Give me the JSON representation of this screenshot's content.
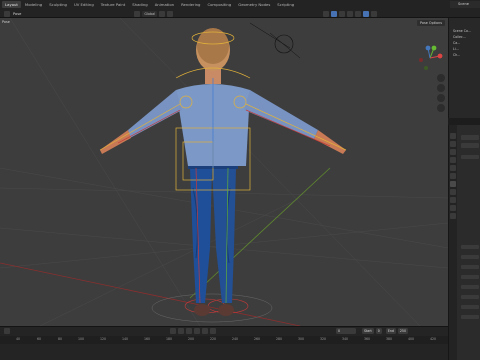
{
  "workspace_tabs": [
    "Layout",
    "Modeling",
    "Sculpting",
    "UV Editing",
    "Texture Paint",
    "Shading",
    "Animation",
    "Rendering",
    "Compositing",
    "Geometry Nodes",
    "Scripting"
  ],
  "active_tab_index": 0,
  "scene_selector": {
    "label": "Scene"
  },
  "viewport_header": {
    "mode": "Pose",
    "pivot": "Global",
    "pose_options": "Pose Options"
  },
  "outliner": {
    "rows": [
      "Scene Co...",
      "Collec...",
      "Ca...",
      "Li...",
      "Ch..."
    ]
  },
  "timeline": {
    "current_frame": "0",
    "start_label": "Start",
    "start_value": "0",
    "end_label": "End",
    "end_value": "250",
    "ticks": [
      "40",
      "60",
      "80",
      "100",
      "120",
      "140",
      "160",
      "180",
      "200",
      "220",
      "240",
      "260",
      "280",
      "300",
      "320",
      "340",
      "360",
      "380",
      "400",
      "420"
    ]
  },
  "colors": {
    "accent": "#4772b3",
    "shirt": "#7c98c6",
    "jeans": "#1f4f99",
    "skin": "#c77a55",
    "bone_selected": "#e2b23a"
  }
}
